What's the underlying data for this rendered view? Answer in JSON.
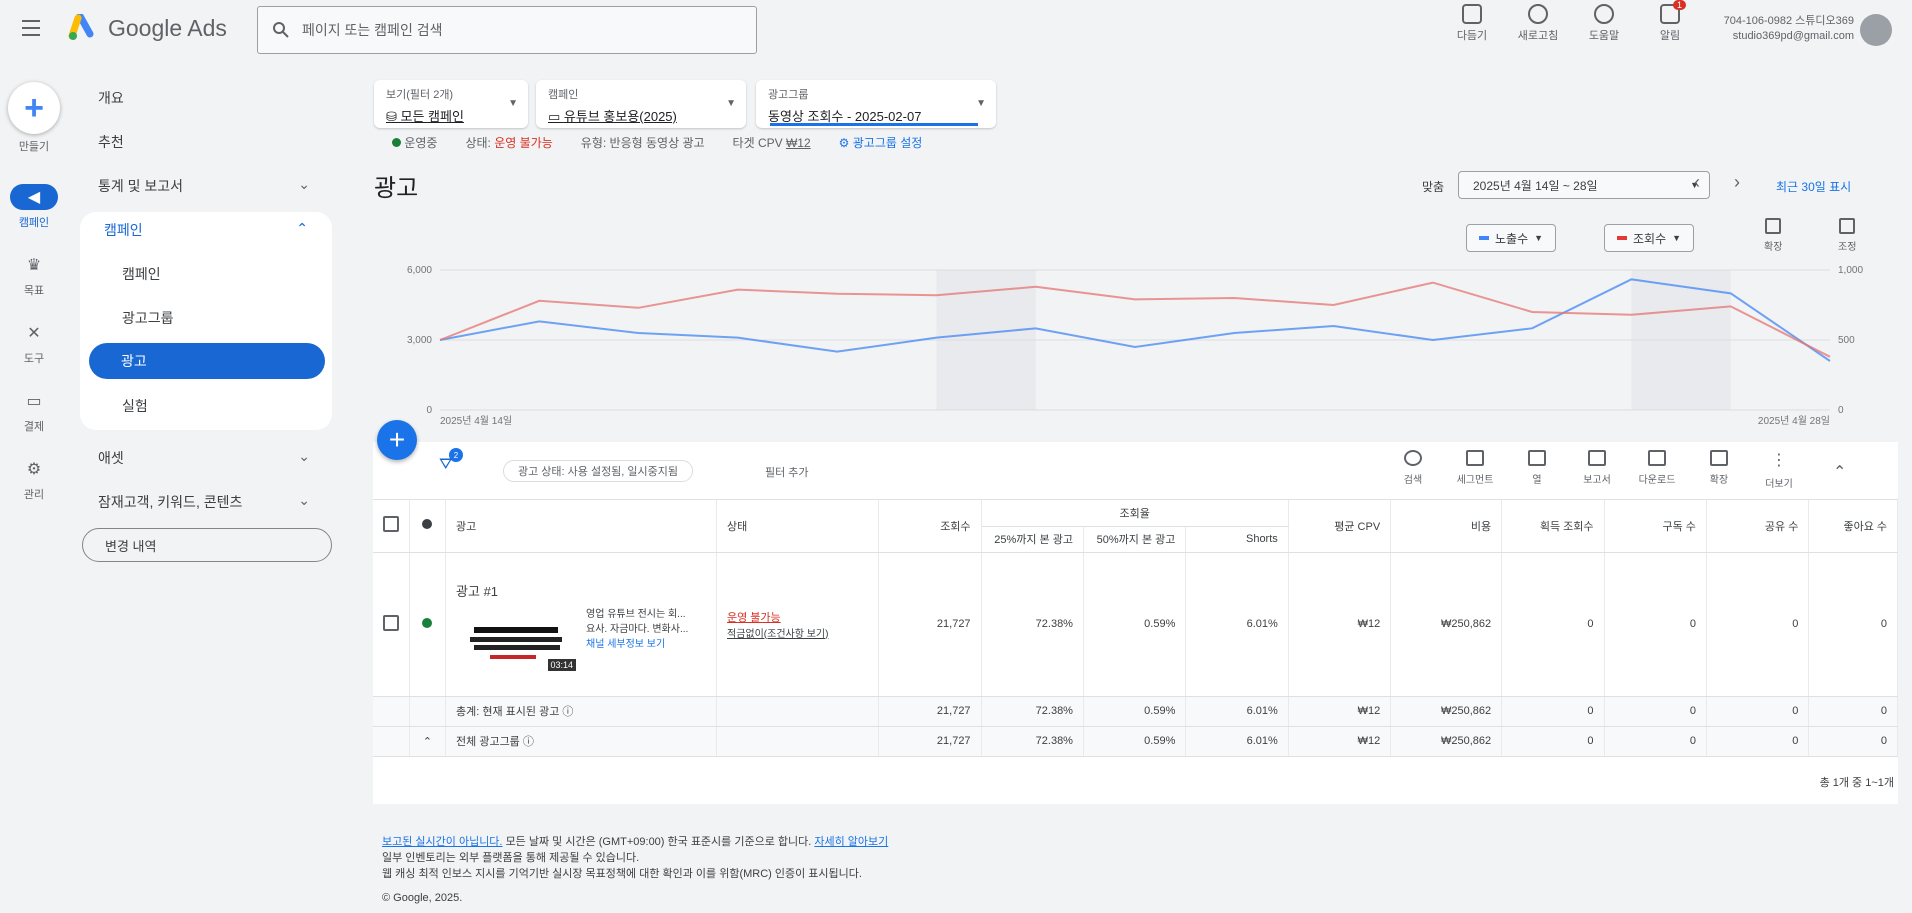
{
  "header": {
    "app_name": "Google Ads",
    "search_placeholder": "페이지 또는 캠페인 검색",
    "actions": [
      {
        "label": "다듬기",
        "icon": "tools-icon"
      },
      {
        "label": "새로고침",
        "icon": "refresh-icon"
      },
      {
        "label": "도움말",
        "icon": "help-icon"
      },
      {
        "label": "알림",
        "icon": "bell-icon",
        "badge": "1"
      }
    ],
    "account_line1": "704-106-0982 스튜디오369",
    "account_line2": "studio369pd@gmail.com"
  },
  "rail": {
    "create_label": "만들기",
    "items": [
      {
        "label": "캠페인",
        "icon": "megaphone-icon",
        "active": true
      },
      {
        "label": "목표",
        "icon": "trophy-icon",
        "active": false
      },
      {
        "label": "도구",
        "icon": "wrench-icon",
        "active": false
      },
      {
        "label": "결제",
        "icon": "billing-icon",
        "active": false
      },
      {
        "label": "관리",
        "icon": "admin-icon",
        "active": false
      }
    ]
  },
  "nav": {
    "overview": "개요",
    "recommendations": "추천",
    "insights": "통계 및 보고서",
    "campaigns": "캠페인",
    "sub": [
      "캠페인",
      "광고그룹",
      "광고",
      "실험"
    ],
    "assets": "애셋",
    "audiences": "잠재고객, 키워드, 콘텐츠",
    "change_history": "변경 내역"
  },
  "scope": {
    "view_label": "보기(필터 2개)",
    "view_value": "모든 캠페인",
    "campaign_label": "캠페인",
    "campaign_value": "유튜브 홍보용(2025)",
    "adgroup_label": "광고그룹",
    "adgroup_value": "동영상 조회수 - 2025-02-07"
  },
  "status_line": {
    "state": "운영중",
    "status_label": "상태:",
    "status_value": "운영 불가능",
    "type": "유형: 반응형 동영상 광고",
    "target": "타겟 CPV",
    "target_value": "₩12",
    "settings_link": "광고그룹 설정"
  },
  "page": {
    "title": "광고",
    "date_label": "맞춤",
    "date_range": "2025년 4월 14일 ~ 28일",
    "recent_link": "최근 30일 표시",
    "metric1": "노출수",
    "metric2": "조회수",
    "expand": "확장",
    "adjust": "조정"
  },
  "chart_data": {
    "type": "line",
    "x": [
      "4/14",
      "4/15",
      "4/16",
      "4/17",
      "4/18",
      "4/19",
      "4/20",
      "4/21",
      "4/22",
      "4/23",
      "4/24",
      "4/25",
      "4/26",
      "4/27",
      "4/28"
    ],
    "x_tick_labels": [
      "2025년 4월 14일",
      "2025년 4월 28일"
    ],
    "y_left_ticks": [
      "0",
      "3,000",
      "6,000"
    ],
    "y_right_ticks": [
      "0",
      "500",
      "1,000"
    ],
    "ylim_left": [
      0,
      6000
    ],
    "ylim_right": [
      0,
      1000
    ],
    "series": [
      {
        "name": "노출수",
        "color": "#4285f4",
        "axis": "left",
        "values": [
          3000,
          3800,
          3300,
          3100,
          2500,
          3100,
          3500,
          2700,
          3300,
          3600,
          3000,
          3500,
          5600,
          5000,
          2100
        ]
      },
      {
        "name": "조회수",
        "color": "#e57373",
        "axis": "right",
        "values": [
          500,
          780,
          730,
          860,
          830,
          820,
          880,
          790,
          800,
          750,
          910,
          700,
          680,
          740,
          380
        ]
      }
    ],
    "shaded_ranges": [
      [
        5,
        6
      ],
      [
        12,
        13
      ]
    ],
    "grid": true
  },
  "table": {
    "filter_chip": "광고 상태: 사용 설정됨, 일시중지됨",
    "add_filter": "필터 추가",
    "tools": [
      "검색",
      "세그먼트",
      "열",
      "보고서",
      "다운로드",
      "확장",
      "더보기"
    ],
    "views_group": "조회율",
    "columns": [
      "광고",
      "상태",
      "조회수",
      "25%까지 본 광고",
      "50%까지 본 광고",
      "Shorts",
      "평균 CPV",
      "비용",
      "획득 조회수",
      "구독 수",
      "공유 수",
      "좋아요 수"
    ],
    "ad": {
      "name": "광고 #1",
      "desc_lines": [
        "영업 유튜브 전시는 회...",
        "요사. 자금마다. 변화사...",
        "채널 세부정보 보기"
      ],
      "thumb_badge": "03:14",
      "status": "운영 불가능",
      "status_detail": "적금없이(조건사항 보기)",
      "values": [
        "21,727",
        "72.38%",
        "0.59%",
        "6.01%",
        "₩12",
        "₩250,862",
        "0",
        "0",
        "0",
        "0"
      ]
    },
    "summary_rows": [
      {
        "label": "총계: 현재 표시된 광고",
        "values": [
          "21,727",
          "72.38%",
          "0.59%",
          "6.01%",
          "₩12",
          "₩250,862",
          "0",
          "0",
          "0",
          "0"
        ]
      },
      {
        "label": "전체 광고그룹",
        "values": [
          "21,727",
          "72.38%",
          "0.59%",
          "6.01%",
          "₩12",
          "₩250,862",
          "0",
          "0",
          "0",
          "0"
        ]
      }
    ],
    "pager": "총 1개 중 1~1개"
  },
  "footer": {
    "line1_link": "보고된 실시간이 아닙니다.",
    "line1_text": "모든 날짜 및 시간은 (GMT+09:00) 한국 표준시를 기준으로 합니다.",
    "line1_link2": "자세히 알아보기",
    "line2": "일부 인벤토리는 외부 플랫폼을 통해 제공될 수 있습니다.",
    "line3": "웹 캐싱 최적 인보스 지시를 기억기반 실시장 목표정책에 대한 확인과 이를 위함(MRC) 인증이 표시됩니다.",
    "copyright": "© Google, 2025."
  }
}
